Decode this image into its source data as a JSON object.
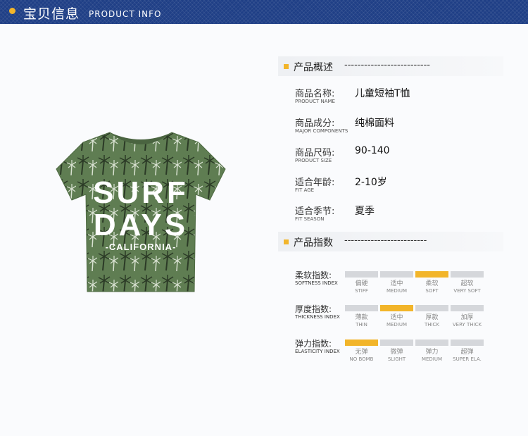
{
  "header": {
    "title_cn": "宝贝信息",
    "title_en": "PRODUCT INFO"
  },
  "product_image": {
    "line1": "SURF",
    "line2": "DAYS",
    "line3": "-CALIFORNIA-"
  },
  "overview": {
    "title": "产品概述",
    "dashes": "--------------------------"
  },
  "info": [
    {
      "label_cn": "商品名称:",
      "label_en": "PRODUCT NAME",
      "value": "儿童短袖T恤"
    },
    {
      "label_cn": "商品成分:",
      "label_en": "MAJOR COMPONENTS",
      "value": "纯棉面料"
    },
    {
      "label_cn": "商品尺码:",
      "label_en": "PRODUCT SIZE",
      "value": "90-140"
    },
    {
      "label_cn": "适合年龄:",
      "label_en": "FIT AGE",
      "value": "2-10岁"
    },
    {
      "label_cn": "适合季节:",
      "label_en": "FIT SEASON",
      "value": "夏季"
    }
  ],
  "indices_section": {
    "title": "产品指数",
    "dashes": "-------------------------"
  },
  "indices": [
    {
      "label_cn": "柔软指数:",
      "label_en": "SOFTNESS INDEX",
      "selected": 2,
      "options": [
        {
          "cn": "偏硬",
          "en": "STIFF"
        },
        {
          "cn": "适中",
          "en": "MEDIUM"
        },
        {
          "cn": "柔软",
          "en": "SOFT"
        },
        {
          "cn": "超软",
          "en": "VERY SOFT"
        }
      ]
    },
    {
      "label_cn": "厚度指数:",
      "label_en": "THICKNESS INDEX",
      "selected": 1,
      "options": [
        {
          "cn": "薄款",
          "en": "THIN"
        },
        {
          "cn": "适中",
          "en": "MEDIUM"
        },
        {
          "cn": "厚款",
          "en": "THICK"
        },
        {
          "cn": "加厚",
          "en": "VERY THICK"
        }
      ]
    },
    {
      "label_cn": "弹力指数:",
      "label_en": "ELASTICITY INDEX",
      "selected": 0,
      "options": [
        {
          "cn": "无弹",
          "en": "NO BOMB"
        },
        {
          "cn": "微弹",
          "en": "SLIGHT"
        },
        {
          "cn": "弹力",
          "en": "MEDIUM"
        },
        {
          "cn": "超弹",
          "en": "SUPER ELA."
        }
      ]
    }
  ],
  "colors": {
    "accent": "#f2b52a",
    "header_bg": "#1f3f86",
    "bar_off": "#d5d7db",
    "shirt": "#5f7d52"
  }
}
